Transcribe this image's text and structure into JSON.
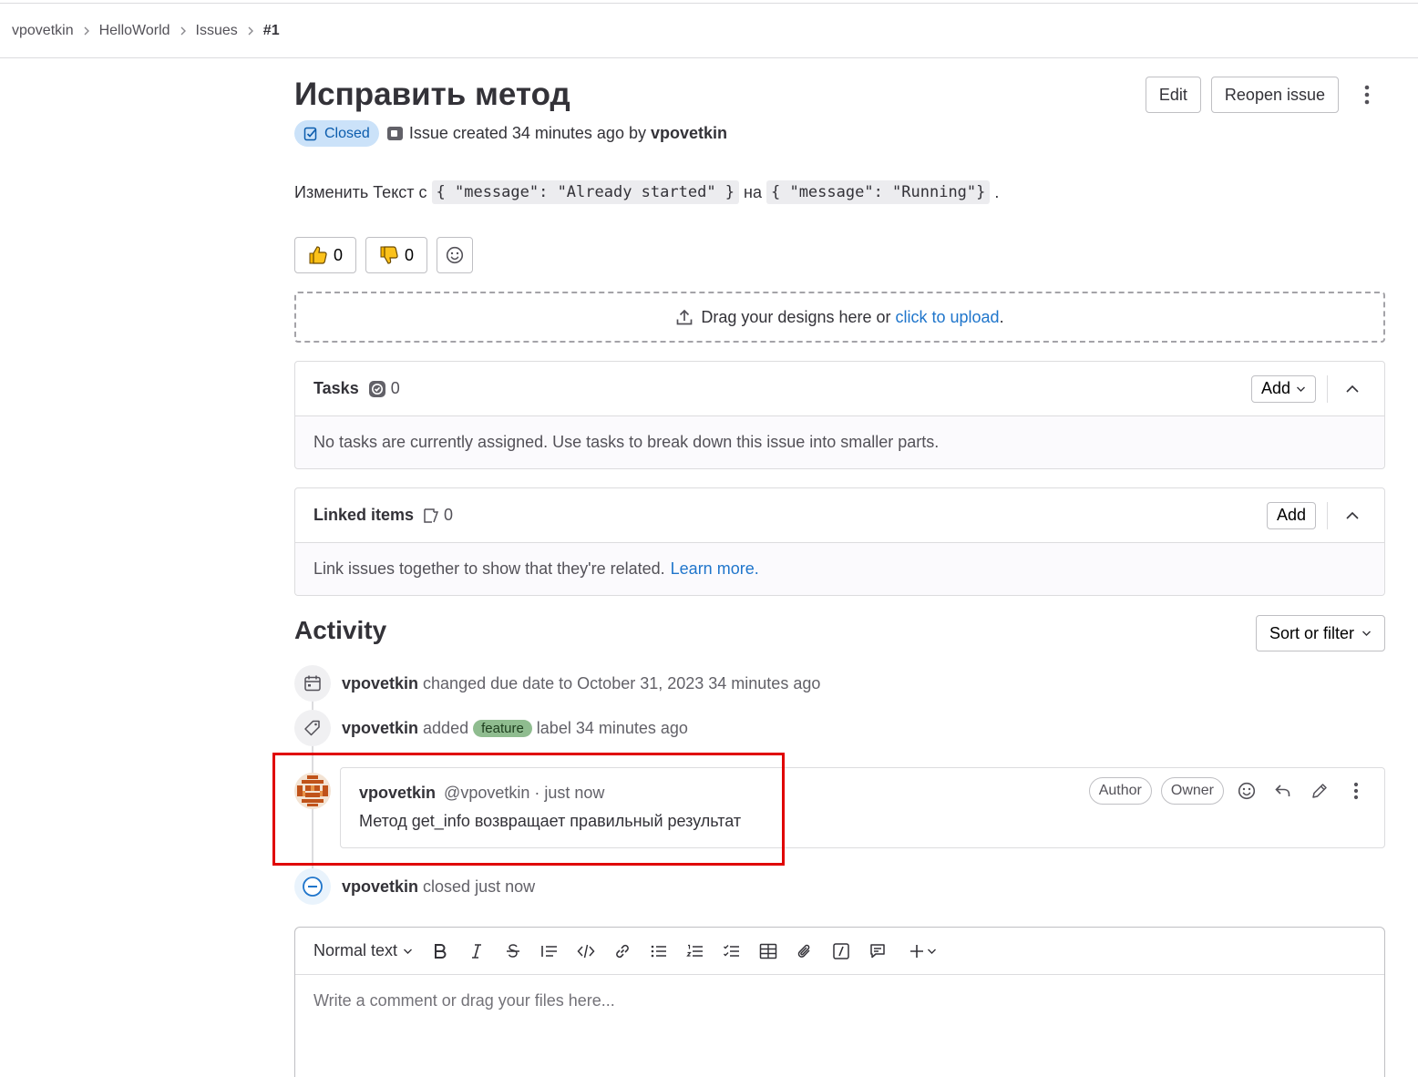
{
  "breadcrumb": {
    "items": [
      "vpovetkin",
      "HelloWorld",
      "Issues"
    ],
    "current": "#1"
  },
  "issue": {
    "title": "Исправить метод",
    "status": "Closed",
    "meta_prefix": "Issue created 34 minutes ago by",
    "author": "vpovetkin",
    "actions": {
      "edit": "Edit",
      "reopen": "Reopen issue"
    },
    "description": {
      "text1": "Изменить Текст с",
      "code1": "{ \"message\": \"Already started\" }",
      "text2": "на",
      "code2": "{ \"message\": \"Running\"}",
      "text3": "."
    }
  },
  "reactions": {
    "thumbs_up": "0",
    "thumbs_down": "0"
  },
  "dropzone": {
    "text": "Drag your designs here or",
    "link": "click to upload",
    "suffix": "."
  },
  "tasks": {
    "title": "Tasks",
    "count": "0",
    "add_label": "Add",
    "empty": "No tasks are currently assigned. Use tasks to break down this issue into smaller parts."
  },
  "linked": {
    "title": "Linked items",
    "count": "0",
    "add_label": "Add",
    "empty": "Link issues together to show that they're related.",
    "learn_more": "Learn more."
  },
  "activity": {
    "title": "Activity",
    "sort_label": "Sort or filter",
    "notes": [
      {
        "user": "vpovetkin",
        "text": "changed due date to October 31, 2023 34 minutes ago"
      },
      {
        "user": "vpovetkin",
        "pre": "added",
        "label": "feature",
        "post": "label 34 minutes ago"
      },
      {
        "user": "vpovetkin",
        "text": "closed just now"
      }
    ],
    "comment": {
      "user": "vpovetkin",
      "handle": "@vpovetkin · just now",
      "body": "Метод get_info возвращает правильный результат",
      "roles": [
        "Author",
        "Owner"
      ]
    }
  },
  "editor": {
    "format": "Normal text",
    "placeholder": "Write a comment or drag your files here..."
  },
  "colors": {
    "accent_blue": "#1f75cb",
    "closed_badge_bg": "#cbe2f9",
    "feature_label": "#8fbc8f",
    "highlight_red": "#e00000"
  },
  "icons": {
    "status": "issue-closed-icon",
    "reactions": [
      "thumbs-up-icon",
      "thumbs-down-icon",
      "smiley-icon"
    ],
    "notes": [
      "calendar-icon",
      "label-icon",
      "status-closed-icon"
    ],
    "toolbar": [
      "bold-icon",
      "italic-icon",
      "strikethrough-icon",
      "quote-icon",
      "code-icon",
      "link-icon",
      "bullet-list-icon",
      "numbered-list-icon",
      "task-list-icon",
      "table-icon",
      "paperclip-icon",
      "slash-command-icon",
      "comment-icon",
      "plus-icon"
    ]
  }
}
